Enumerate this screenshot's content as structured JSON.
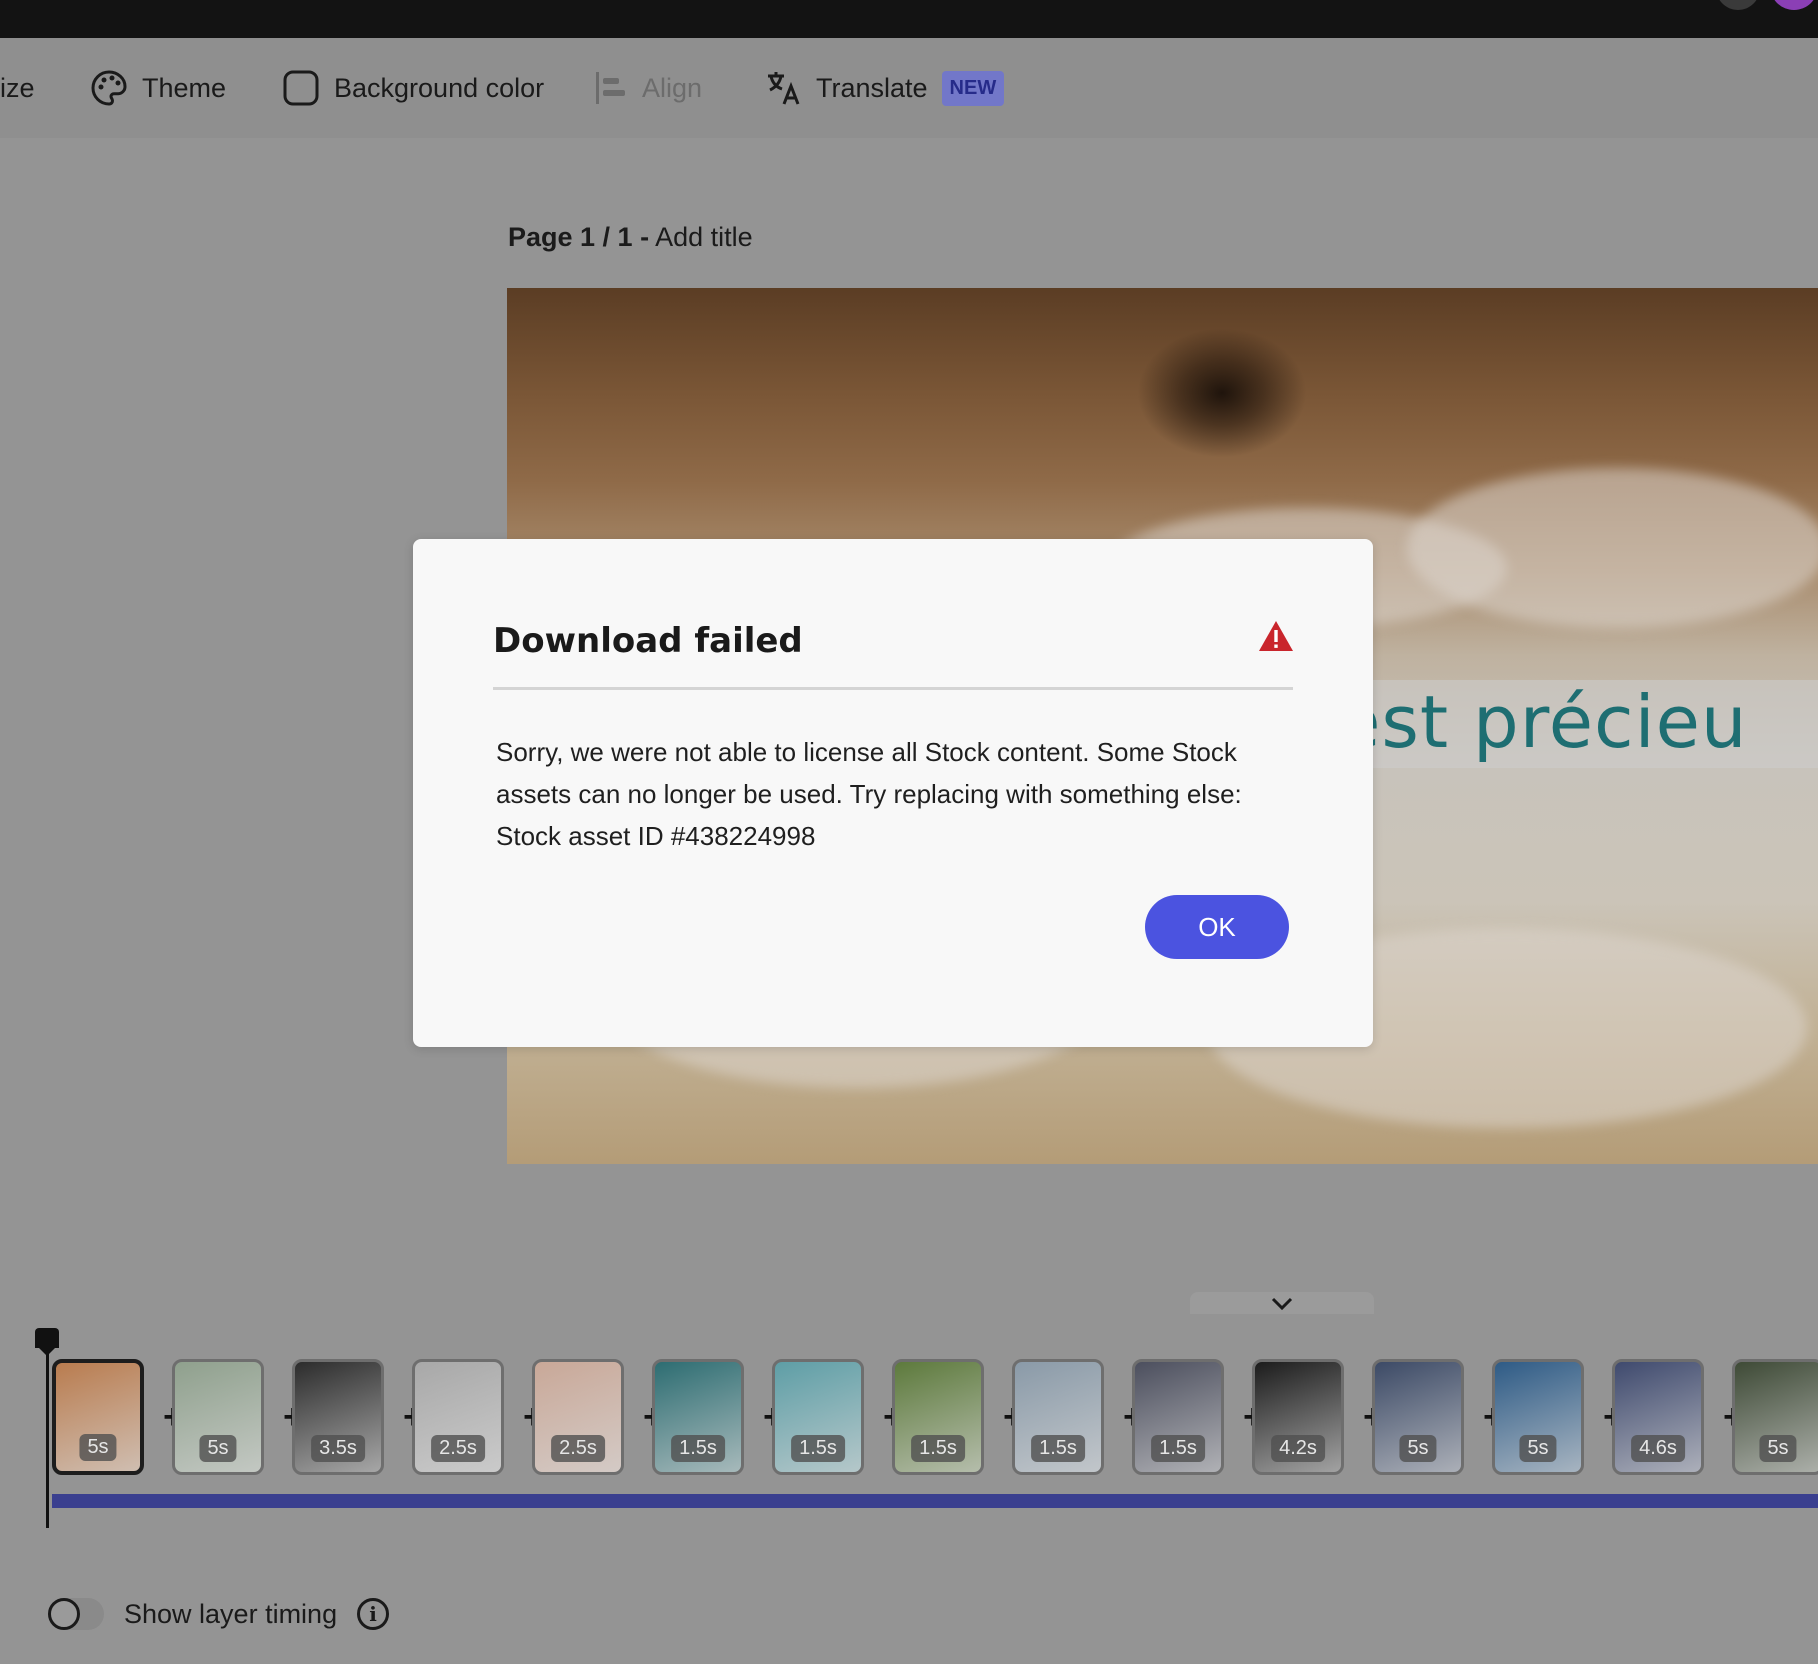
{
  "toolbar": {
    "resize_label": "ize",
    "theme_label": "Theme",
    "background_label": "Background color",
    "align_label": "Align",
    "translate_label": "Translate",
    "translate_badge": "NEW"
  },
  "page": {
    "label_bold": "Page 1 / 1 -",
    "label_title": "Add title",
    "slide_text": "ps est précieu"
  },
  "dialog": {
    "title": "Download failed",
    "body": "Sorry, we were not able to license all Stock content. Some Stock assets can no longer be used. Try replacing with something else: Stock asset ID #438224998",
    "ok_label": "OK",
    "warning_color": "#c9252c"
  },
  "timeline": {
    "clips": [
      {
        "duration": "5s",
        "color": "#b97c4f",
        "selected": true
      },
      {
        "duration": "5s",
        "color": "#8fa08d"
      },
      {
        "duration": "3.5s",
        "color": "#2c2c2c"
      },
      {
        "duration": "2.5s",
        "color": "#a8a8a8"
      },
      {
        "duration": "2.5s",
        "color": "#c9a898"
      },
      {
        "duration": "1.5s",
        "color": "#2d6d72"
      },
      {
        "duration": "1.5s",
        "color": "#5e9ea6"
      },
      {
        "duration": "1.5s",
        "color": "#5d7a3c"
      },
      {
        "duration": "1.5s",
        "color": "#8a9aa8"
      },
      {
        "duration": "1.5s",
        "color": "#4c4f5e"
      },
      {
        "duration": "4.2s",
        "color": "#1c1c1c"
      },
      {
        "duration": "5s",
        "color": "#3c4a66"
      },
      {
        "duration": "5s",
        "color": "#2e5b86"
      },
      {
        "duration": "4.6s",
        "color": "#3f4a6e"
      },
      {
        "duration": "5s",
        "color": "#3e4a36"
      }
    ],
    "layer_timing_label": "Show layer timing"
  }
}
